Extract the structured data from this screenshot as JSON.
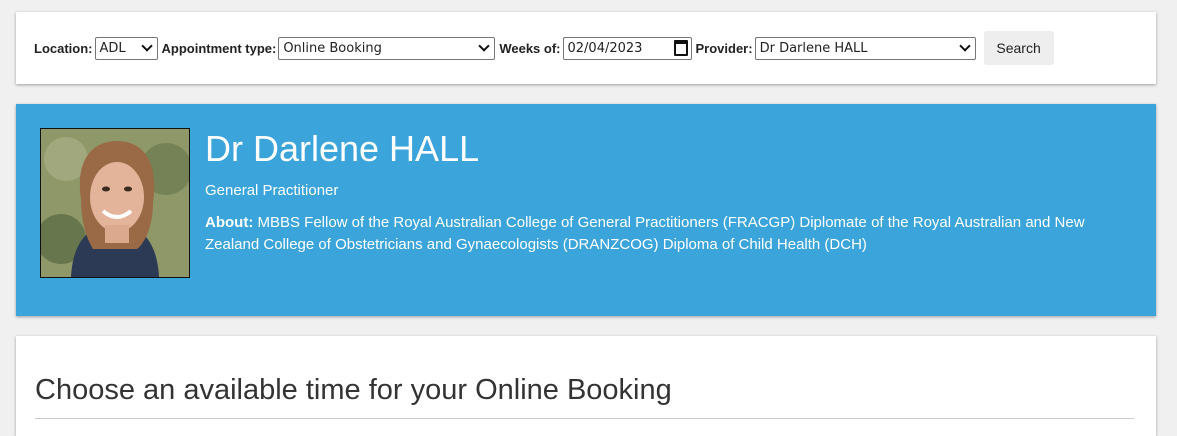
{
  "search": {
    "location_label": "Location:",
    "location_value": "ADL",
    "appointment_type_label": "Appointment type:",
    "appointment_type_value": "Online Booking",
    "weeks_of_label": "Weeks of:",
    "weeks_of_value": "02/04/2023",
    "provider_label": "Provider:",
    "provider_value": "Dr Darlene HALL",
    "search_button": "Search"
  },
  "provider": {
    "name": "Dr Darlene HALL",
    "title": "General Practitioner",
    "about_label": "About:",
    "about_text": "MBBS Fellow of the Royal Australian College of General Practitioners (FRACGP) Diplomate of the Royal Australian and New Zealand College of Obstetricians and Gynaecologists (DRANZCOG) Diploma of Child Health (DCH)"
  },
  "times": {
    "heading": "Choose an available time for your Online Booking"
  },
  "colors": {
    "provider_banner": "#3ba4da",
    "page_background": "#f0f0f0"
  }
}
